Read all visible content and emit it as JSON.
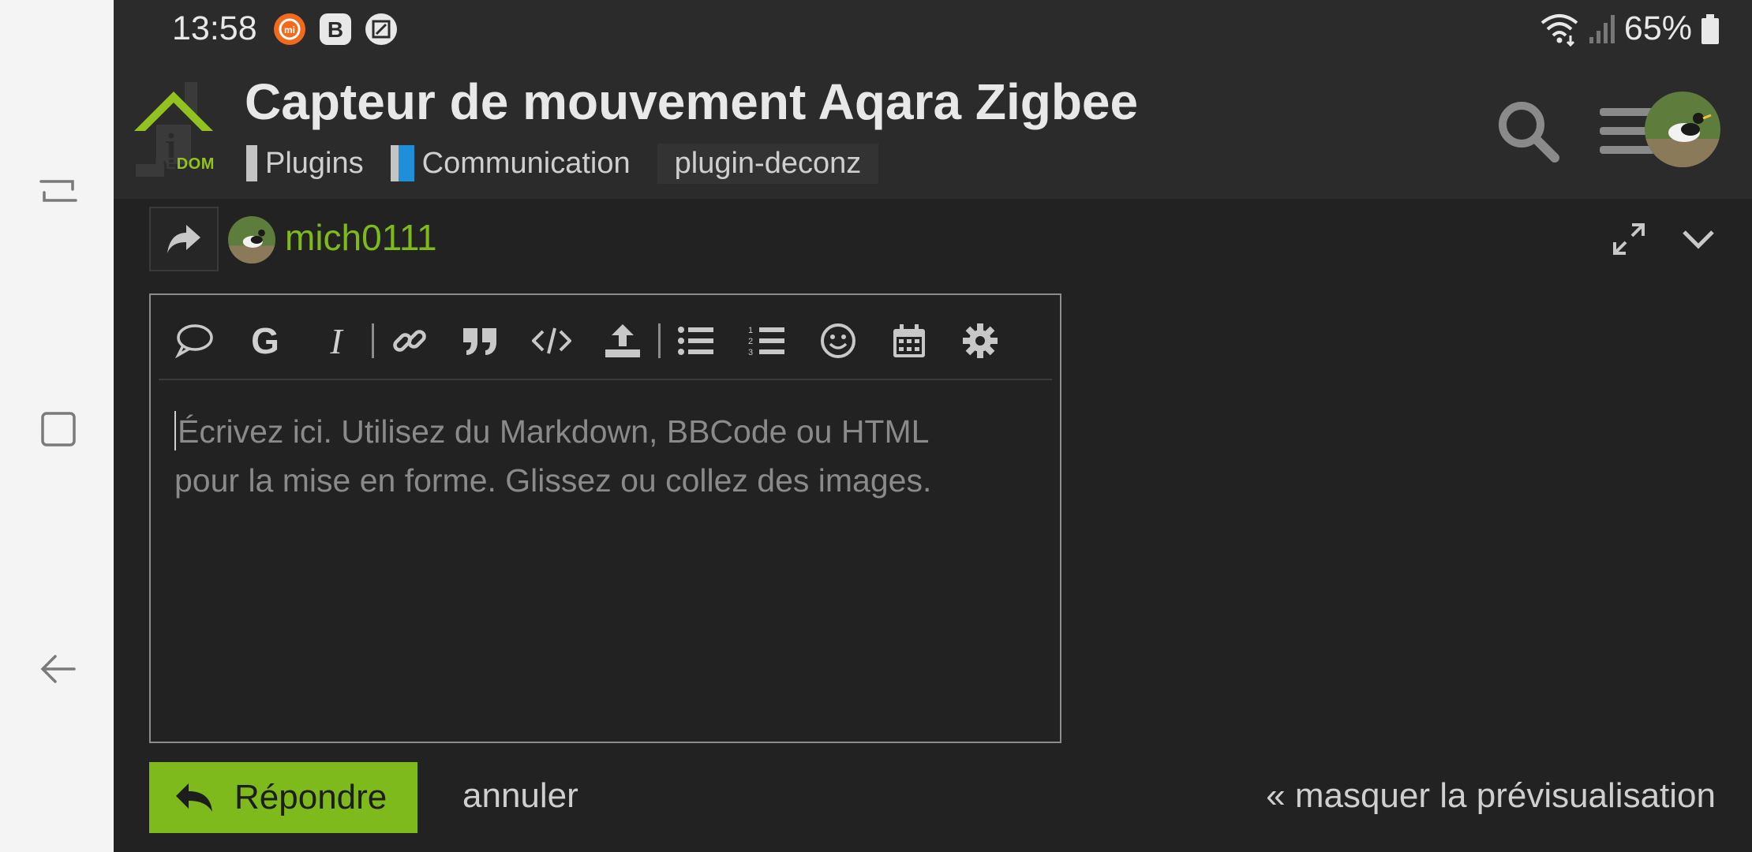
{
  "status_bar": {
    "time": "13:58",
    "battery_text": "65%",
    "icons": [
      "mi-app-icon",
      "b-app-icon",
      "screenshot-icon",
      "wifi-icon",
      "signal-icon",
      "battery-icon"
    ]
  },
  "header": {
    "logo_text_left": "EE",
    "logo_text_right": "DOM",
    "title": "Capteur de mouvement Aqara Zigbee",
    "categories": [
      {
        "label": "Plugins"
      },
      {
        "label": "Communication"
      }
    ],
    "tag": "plugin-deconz"
  },
  "composer": {
    "username": "mich0111",
    "placeholder_line1": "Écrivez ici. Utilisez du Markdown, BBCode ou HTML",
    "placeholder_line2": "pour la mise en forme. Glissez ou collez des images.",
    "toolbar_bold": "G",
    "toolbar_italic": "I",
    "reply_label": "Répondre",
    "cancel_label": "annuler",
    "hide_preview_label": "« masquer la prévisualisation"
  },
  "colors": {
    "accent": "#7fba1d",
    "background": "#222222",
    "header": "#2b2b2b",
    "category_communication": "#1e8fd8"
  }
}
